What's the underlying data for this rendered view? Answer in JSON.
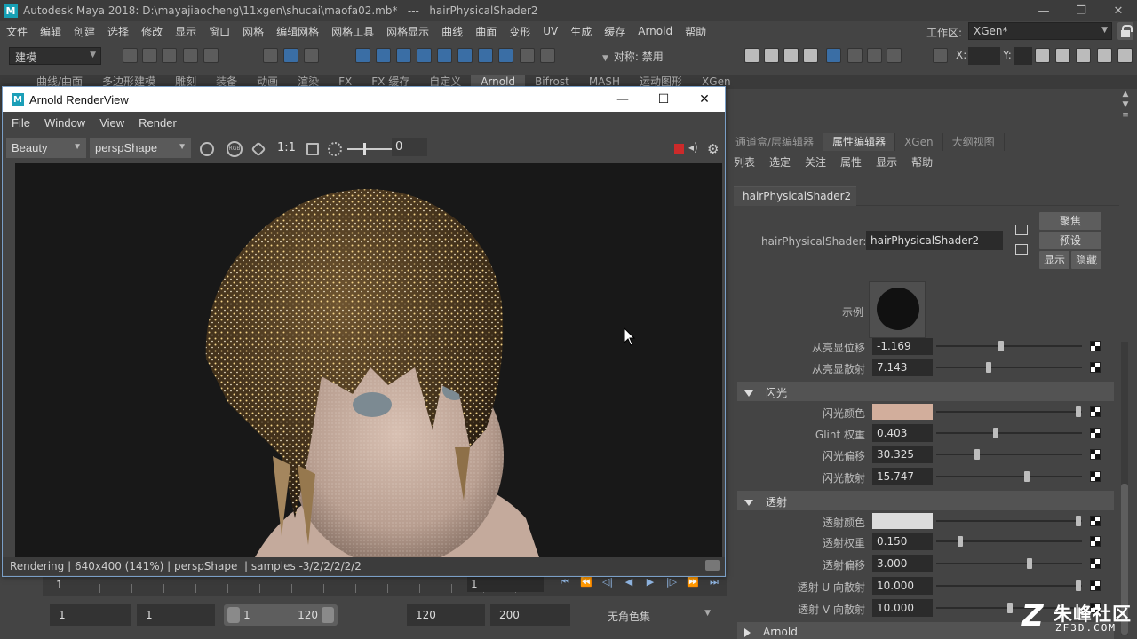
{
  "app": {
    "title": "Autodesk Maya 2018: D:\\mayajiaocheng\\11xgen\\shucai\\maofa02.mb*   ---   hairPhysicalShader2",
    "window_controls": [
      "—",
      "❐",
      "✕"
    ]
  },
  "menu": [
    "文件",
    "编辑",
    "创建",
    "选择",
    "修改",
    "显示",
    "窗口",
    "网格",
    "编辑网格",
    "网格工具",
    "网格显示",
    "曲线",
    "曲面",
    "变形",
    "UV",
    "生成",
    "缓存",
    "Arnold",
    "帮助"
  ],
  "workspace": {
    "label": "工作区:",
    "value": "XGen*"
  },
  "toolbar": {
    "mode": "建模",
    "symmetry": "对称: 禁用",
    "x_label": "X:",
    "y_label": "Y:"
  },
  "shelf_tabs": [
    "曲线/曲面",
    "多边形建模",
    "雕刻",
    "装备",
    "动画",
    "渲染",
    "FX",
    "FX 缓存",
    "自定义",
    "Arnold",
    "Bifrost",
    "MASH",
    "运动图形",
    "XGen"
  ],
  "shelf_active": "Arnold",
  "attr_editor": {
    "tabs": [
      "通道盒/层编辑器",
      "属性编辑器",
      "XGen",
      "大纲视图"
    ],
    "active_tab": "属性编辑器",
    "menu": [
      "列表",
      "选定",
      "关注",
      "属性",
      "显示",
      "帮助"
    ],
    "node_tab": "hairPhysicalShader2",
    "shader_label": "hairPhysicalShader:",
    "shader_value": "hairPhysicalShader2",
    "buttons": {
      "focus": "聚焦",
      "presets": "预设",
      "show": "显示",
      "hide": "隐藏"
    },
    "sample_label": "示例",
    "rows_top": [
      {
        "label": "从亮显位移",
        "value": "-1.169",
        "pos": 0.44
      },
      {
        "label": "从亮显散射",
        "value": "7.143",
        "pos": 0.35
      }
    ],
    "section_glint": "闪光",
    "rows_glint": [
      {
        "label": "闪光颜色",
        "color": "#d2ae9c",
        "pos": 0.98
      },
      {
        "label": "Glint 权重",
        "value": "0.403",
        "pos": 0.4
      },
      {
        "label": "闪光偏移",
        "value": "30.325",
        "pos": 0.27
      },
      {
        "label": "闪光散射",
        "value": "15.747",
        "pos": 0.62
      }
    ],
    "section_trans": "透射",
    "rows_trans": [
      {
        "label": "透射颜色",
        "color": "#dcdcdc",
        "pos": 0.98
      },
      {
        "label": "透射权重",
        "value": "0.150",
        "pos": 0.15
      },
      {
        "label": "透射偏移",
        "value": "3.000",
        "pos": 0.64
      },
      {
        "label": "透射 U 向散射",
        "value": "10.000",
        "pos": 0.98
      },
      {
        "label": "透射 V 向散射",
        "value": "10.000",
        "pos": 0.5
      }
    ],
    "section_arnold": "Arnold"
  },
  "renderview": {
    "title": "Arnold RenderView",
    "menu": [
      "File",
      "Window",
      "View",
      "Render"
    ],
    "aov": "Beauty",
    "camera": "perspShape",
    "ratio": "1:1",
    "exposure": "0",
    "status": "Rendering | 640x400 (141%) | perspShape  | samples -3/2/2/2/2/2"
  },
  "timeline": {
    "start_label": "1",
    "current_frame": "1",
    "range_start": "1",
    "range_inner_start": "1",
    "range_inner_end": "120",
    "range_end": "120",
    "anim_end": "200",
    "charset": "无角色集"
  },
  "watermark": {
    "glyph": "Z",
    "cn": "朱峰社区",
    "en": "ZF3D.COM"
  },
  "colors": {
    "render_bg": "#181818",
    "stop": "#cc2a2a",
    "accent": "#17a0b5"
  }
}
